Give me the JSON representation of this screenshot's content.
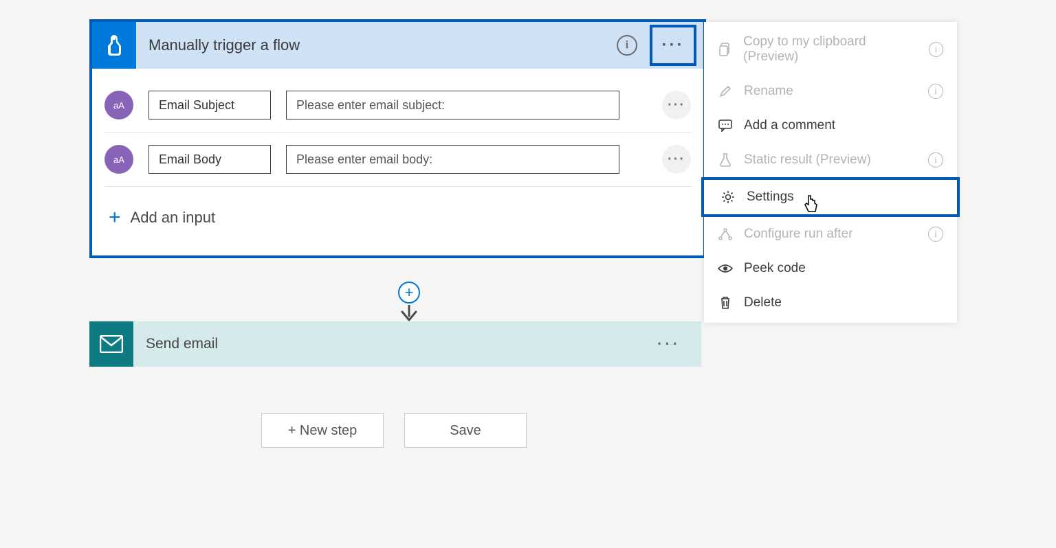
{
  "trigger": {
    "title": "Manually trigger a flow",
    "inputs": [
      {
        "iconText": "aA",
        "name": "Email Subject",
        "placeholder": "Please enter email subject:"
      },
      {
        "iconText": "aA",
        "name": "Email Body",
        "placeholder": "Please enter email body:"
      }
    ],
    "addInputLabel": "Add an input"
  },
  "sendEmail": {
    "title": "Send email"
  },
  "buttons": {
    "newStep": "+ New step",
    "save": "Save"
  },
  "menu": {
    "items": [
      {
        "label": "Copy to my clipboard (Preview)",
        "icon": "copy",
        "state": "disabled",
        "info": true
      },
      {
        "label": "Rename",
        "icon": "pencil",
        "state": "disabled",
        "info": true
      },
      {
        "label": "Add a comment",
        "icon": "comment",
        "state": "enabled",
        "info": false
      },
      {
        "label": "Static result (Preview)",
        "icon": "flask",
        "state": "disabled",
        "info": true
      },
      {
        "label": "Settings",
        "icon": "gear",
        "state": "enabled",
        "info": false,
        "highlighted": true
      },
      {
        "label": "Configure run after",
        "icon": "branch",
        "state": "disabled",
        "info": true
      },
      {
        "label": "Peek code",
        "icon": "eye",
        "state": "enabled",
        "info": false
      },
      {
        "label": "Delete",
        "icon": "trash",
        "state": "enabled",
        "info": false
      }
    ]
  }
}
